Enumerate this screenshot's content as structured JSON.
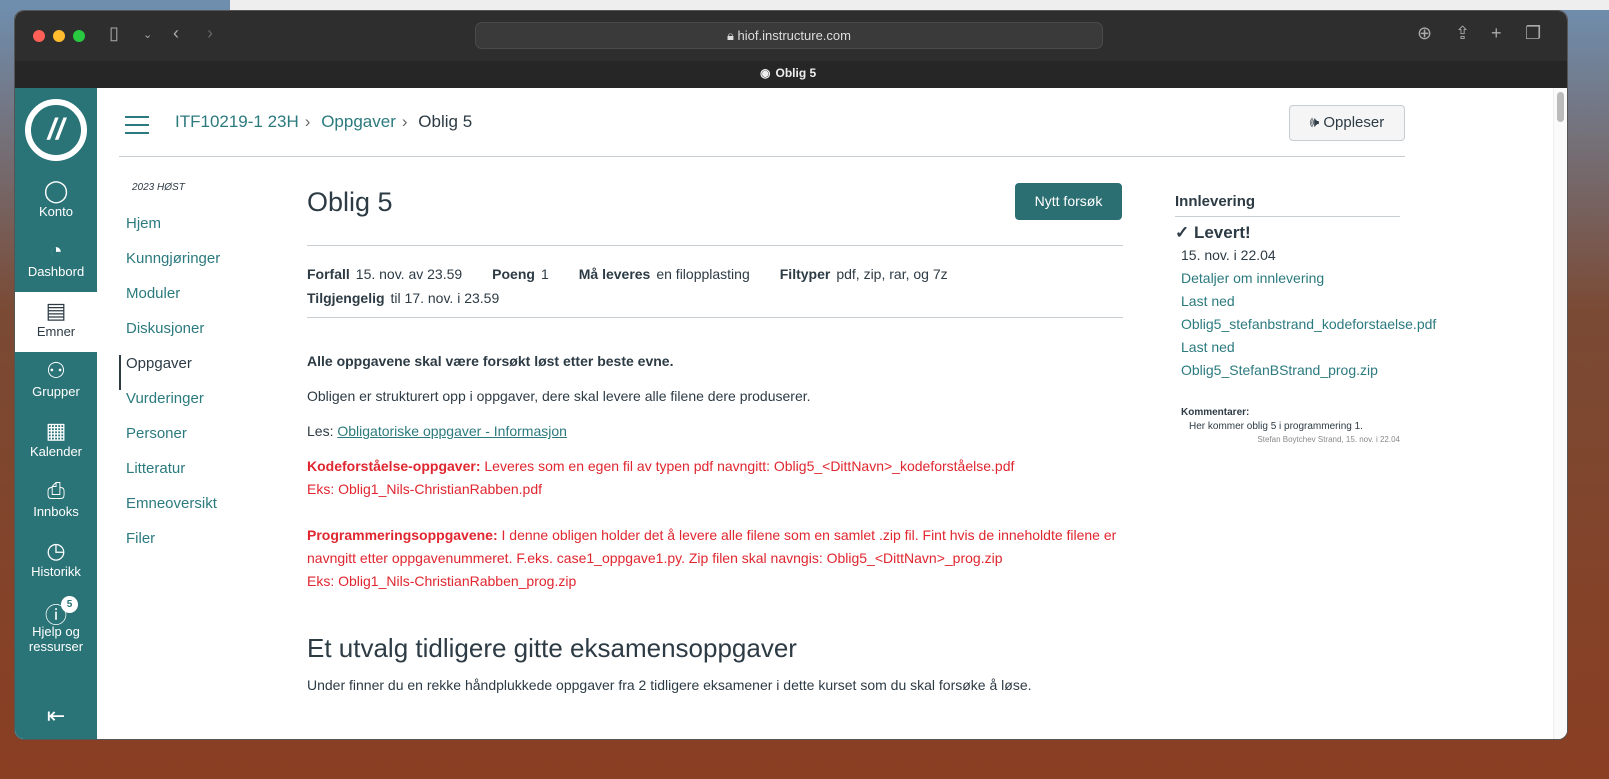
{
  "browser": {
    "url": "hiof.instructure.com",
    "tab_title": "Oblig 5"
  },
  "global_nav": [
    {
      "label": "Konto",
      "icon": "avatar-icon"
    },
    {
      "label": "Dashbord",
      "icon": "gauge-icon"
    },
    {
      "label": "Emner",
      "icon": "book-icon"
    },
    {
      "label": "Grupper",
      "icon": "people-icon"
    },
    {
      "label": "Kalender",
      "icon": "calendar-icon"
    },
    {
      "label": "Innboks",
      "icon": "inbox-icon"
    },
    {
      "label": "Historikk",
      "icon": "clock-icon"
    },
    {
      "label": "Hjelp og ressurser",
      "icon": "info-icon",
      "badge": "5"
    }
  ],
  "breadcrumb": [
    "ITF10219-1 23H",
    "Oppgaver",
    "Oblig 5"
  ],
  "oppleser": "Oppleser",
  "course_nav": {
    "term": "2023 HØST",
    "items": [
      "Hjem",
      "Kunngjøringer",
      "Moduler",
      "Diskusjoner",
      "Oppgaver",
      "Vurderinger",
      "Personer",
      "Litteratur",
      "Emneoversikt",
      "Filer"
    ],
    "active": "Oppgaver"
  },
  "assignment": {
    "title": "Oblig 5",
    "retry_button": "Nytt forsøk",
    "meta": [
      {
        "label": "Forfall",
        "value": "15. nov. av 23.59"
      },
      {
        "label": "Poeng",
        "value": "1"
      },
      {
        "label": "Må leveres",
        "value": "en filopplasting"
      },
      {
        "label": "Filtyper",
        "value": "pdf, zip, rar, og 7z"
      },
      {
        "label": "Tilgjengelig",
        "value": "til 17. nov. i 23.59"
      }
    ],
    "p1": "Alle oppgavene skal være forsøkt løst etter beste evne.",
    "p2": "Obligen er strukturert opp i oppgaver, dere skal levere alle filene dere produserer.",
    "p3_prefix": "Les: ",
    "p3_link": "Obligatoriske oppgaver - Informasjon",
    "kode_label": "Kodeforståelse-oppgaver:",
    "kode_text": " Leveres som en egen fil av typen pdf navngitt:  Oblig5_<DittNavn>_kodeforståelse.pdf",
    "kode_eks": "Eks: Oblig1_Nils-ChristianRabben.pdf",
    "prog_label": "Programmeringsoppgavene:",
    "prog_text": " I denne obligen holder det å levere alle filene som en samlet .zip fil. Fint hvis de inneholdte filene er navngitt etter oppgavenummeret. F.eks. case1_oppgave1.py.    Zip filen skal navngis: Oblig5_<DittNavn>_prog.zip",
    "prog_eks": "Eks: Oblig1_Nils-ChristianRabben_prog.zip",
    "h2": "Et utvalg tidligere gitte eksamensoppgaver",
    "p4": "Under finner du en rekke håndplukkede oppgaver fra 2 tidligere eksamener i dette kurset som du skal forsøke å løse."
  },
  "submission": {
    "heading": "Innlevering",
    "status": "Levert!",
    "date": "15. nov. i 22.04",
    "details": "Detaljer om innlevering",
    "download1": "Last ned",
    "file1": "Oblig5_stefanbstrand_kodeforstaelse.pdf",
    "download2": "Last ned",
    "file2": "Oblig5_StefanBStrand_prog.zip",
    "comments_label": "Kommentarer:",
    "comment": "Her kommer oblig 5 i programmering 1.",
    "comment_meta": "Stefan Boytchev Strand, 15. nov. i 22.04"
  }
}
